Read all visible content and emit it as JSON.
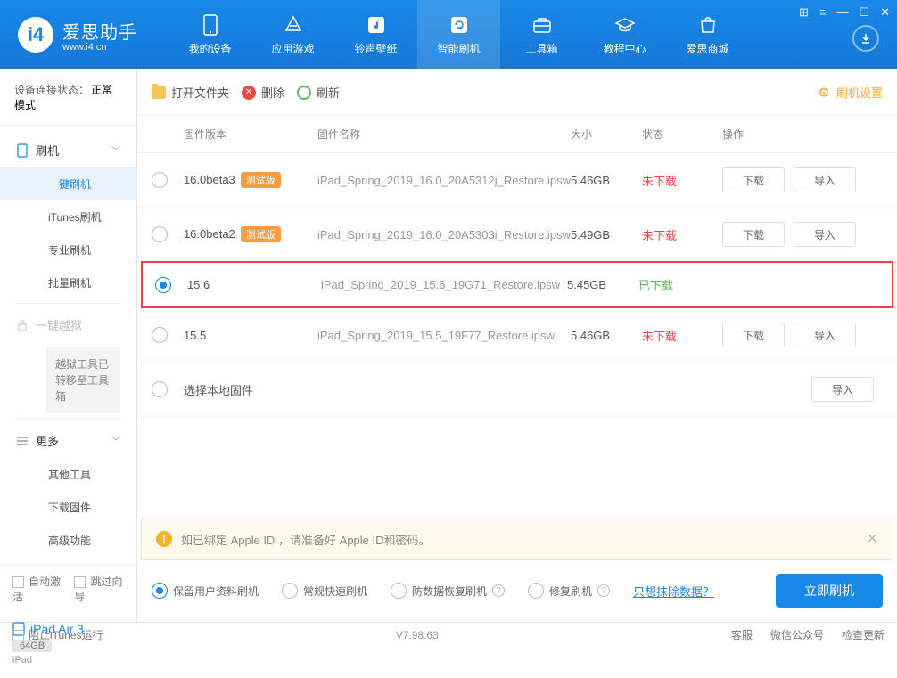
{
  "header": {
    "brand": "爱思助手",
    "site": "www.i4.cn",
    "tabs": [
      {
        "label": "我的设备"
      },
      {
        "label": "应用游戏"
      },
      {
        "label": "铃声壁纸"
      },
      {
        "label": "智能刷机"
      },
      {
        "label": "工具箱"
      },
      {
        "label": "教程中心"
      },
      {
        "label": "爱思商城"
      }
    ]
  },
  "sidebar": {
    "conn_label": "设备连接状态：",
    "conn_mode": "正常模式",
    "sections": {
      "flash_header": "刷机",
      "items": [
        "一键刷机",
        "iTunes刷机",
        "专业刷机",
        "批量刷机"
      ],
      "jailbreak_header": "一键越狱",
      "jailbreak_note": "越狱工具已转移至工具箱",
      "more_header": "更多",
      "more_items": [
        "其他工具",
        "下载固件",
        "高级功能"
      ]
    },
    "auto_activate": "自动激活",
    "skip_guide": "跳过向导",
    "device": {
      "name": "iPad Air 3",
      "storage": "64GB",
      "type": "iPad"
    }
  },
  "toolbar": {
    "open_folder": "打开文件夹",
    "delete": "删除",
    "refresh": "刷新",
    "settings": "刷机设置"
  },
  "table": {
    "headers": {
      "version": "固件版本",
      "name": "固件名称",
      "size": "大小",
      "status": "状态",
      "ops": "操作"
    },
    "rows": [
      {
        "version": "16.0beta3",
        "beta": true,
        "beta_tag": "测试版",
        "name": "iPad_Spring_2019_16.0_20A5312j_Restore.ipsw",
        "size": "5.46GB",
        "status": "未下载",
        "status_cls": "not",
        "selected": false,
        "show_ops": true
      },
      {
        "version": "16.0beta2",
        "beta": true,
        "beta_tag": "测试版",
        "name": "iPad_Spring_2019_16.0_20A5303i_Restore.ipsw",
        "size": "5.49GB",
        "status": "未下载",
        "status_cls": "not",
        "selected": false,
        "show_ops": true
      },
      {
        "version": "15.6",
        "beta": false,
        "name": "iPad_Spring_2019_15.6_19G71_Restore.ipsw",
        "size": "5.45GB",
        "status": "已下载",
        "status_cls": "done",
        "selected": true,
        "highlight": true,
        "show_ops": false
      },
      {
        "version": "15.5",
        "beta": false,
        "name": "iPad_Spring_2019_15.5_19F77_Restore.ipsw",
        "size": "5.46GB",
        "status": "未下载",
        "status_cls": "not",
        "selected": false,
        "show_ops": true
      }
    ],
    "local_row": "选择本地固件",
    "download_btn": "下载",
    "import_btn": "导入"
  },
  "info_bar": "如已绑定 Apple ID ，请准备好 Apple ID和密码。",
  "options": {
    "keep_data": "保留用户资料刷机",
    "normal": "常规快速刷机",
    "recovery": "防数据恢复刷机",
    "repair": "修复刷机",
    "erase_link": "只想抹除数据？",
    "flash_btn": "立即刷机"
  },
  "footer": {
    "block_itunes": "阻止iTunes运行",
    "version": "V7.98.63",
    "links": [
      "客服",
      "微信公众号",
      "检查更新"
    ]
  }
}
